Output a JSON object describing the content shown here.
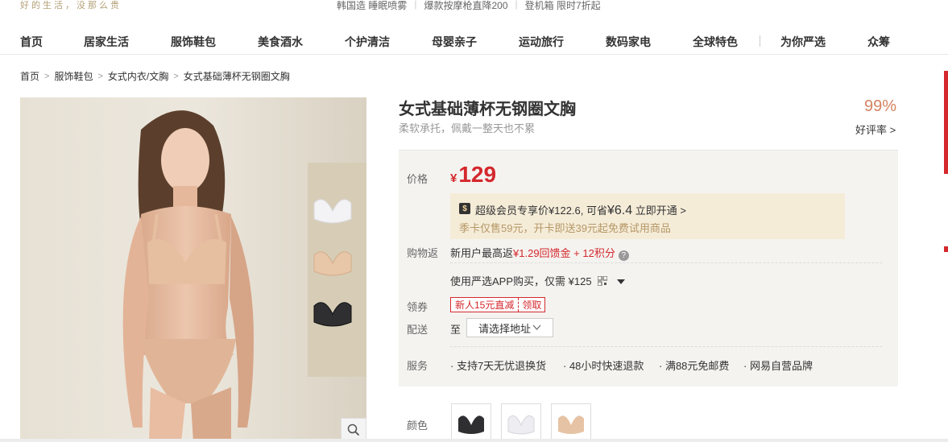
{
  "topbar": {
    "slogan": "好的生活，没那么贵",
    "promos": [
      "韩国造 睡眠喷雾",
      "爆款按摩枪直降200",
      "登机箱 限时7折起"
    ]
  },
  "nav": [
    "首页",
    "居家生活",
    "服饰鞋包",
    "美食酒水",
    "个护清洁",
    "母婴亲子",
    "运动旅行",
    "数码家电",
    "全球特色",
    "为你严选",
    "众筹"
  ],
  "breadcrumb": [
    "首页",
    "服饰鞋包",
    "女式内衣/文胸",
    "女式基础薄杯无钢圈文胸"
  ],
  "product": {
    "title": "女式基础薄杯无钢圈文胸",
    "subtitle": "柔软承托，佩戴一整天也不累",
    "rating_value": "99%",
    "rating_label": "好评率 >",
    "price_label": "价格",
    "currency": "¥",
    "price": "129",
    "vip_badge": "$",
    "vip_text": "超级会员专享价¥122.6, 可省",
    "vip_save": "¥6.4",
    "vip_action": " 立即开通 >",
    "vip_note": "季卡仅售59元，开卡即送39元起免费试用商品",
    "rebate_label": "购物返",
    "rebate_prefix": "新用户最高返",
    "rebate_value": "¥1.29回馈金 + 12积分",
    "rebate_help": "?",
    "app_text": "使用严选APP购买，仅需 ¥125",
    "coupon_label": "领券",
    "coupon_text": "新人15元直减",
    "coupon_action": "领取",
    "delivery_label": "配送",
    "delivery_to": "至",
    "delivery_placeholder": "请选择地址",
    "service_label": "服务",
    "services": [
      "· 支持7天无忧退换货",
      "· 48小时快速退款",
      "· 满88元免邮费",
      "· 网易自营品牌"
    ],
    "color_label": "颜色"
  },
  "icons": {
    "zoom": "search-icon",
    "dropdown": "caret-down-icon",
    "qr": "qrcode-icon",
    "chevron": "chevron-down-icon"
  },
  "colors": {
    "accent_red": "#d4282d",
    "gold": "#b4a078",
    "rating_orange": "#d4835f",
    "vip_bg": "#f5ecd8"
  }
}
